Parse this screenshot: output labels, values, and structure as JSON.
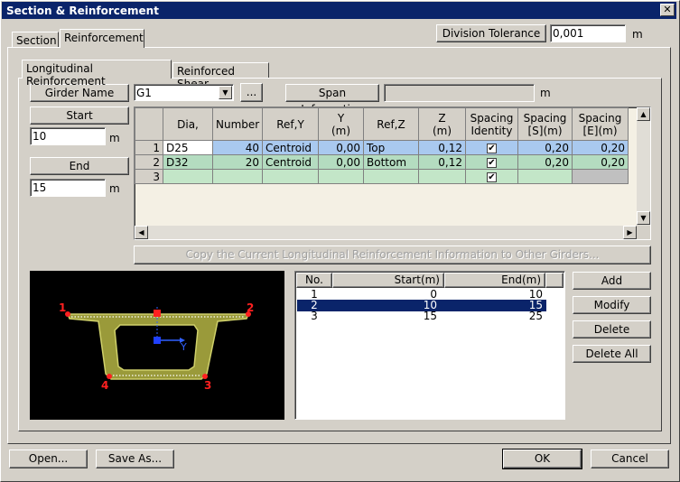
{
  "window": {
    "title": "Section & Reinforcement",
    "close_glyph": "✕"
  },
  "tabs": {
    "section": "Section",
    "reinforcement": "Reinforcement"
  },
  "division_tolerance": {
    "label": "Division Tolerance",
    "value": "0,001",
    "unit": "m"
  },
  "subtabs": {
    "longitudinal": "Longitudinal Reinforcement",
    "shear": "Reinforced Shear"
  },
  "girder": {
    "label": "Girder Name",
    "value": "G1",
    "browse_label": "...",
    "span_label": "Span Information",
    "span_value": "",
    "span_unit": "m"
  },
  "start": {
    "label": "Start",
    "value": "10",
    "unit": "m"
  },
  "end": {
    "label": "End",
    "value": "15",
    "unit": "m"
  },
  "grid": {
    "headers": [
      "",
      "Dia,",
      "Number",
      "Ref,Y",
      "Y\n(m)",
      "Ref,Z",
      "Z\n(m)",
      "Spacing\nIdentity",
      "Spacing\n[S](m)",
      "Spacing\n[E](m)"
    ],
    "rows": [
      {
        "no": "1",
        "dia": "D25",
        "number": "40",
        "refy": "Centroid",
        "y": "0,00",
        "refz": "Top",
        "z": "0,12",
        "identity": true,
        "ss": "0,20",
        "se": "0,20"
      },
      {
        "no": "2",
        "dia": "D32",
        "number": "20",
        "refy": "Centroid",
        "y": "0,00",
        "refz": "Bottom",
        "z": "0,12",
        "identity": true,
        "ss": "0,20",
        "se": "0,20"
      },
      {
        "no": "3",
        "dia": "",
        "number": "",
        "refy": "",
        "y": "",
        "refz": "",
        "z": "",
        "identity": true,
        "ss": "",
        "se": ""
      }
    ]
  },
  "copy_button": "Copy the Current Longitudinal Reinforcement Information to Other Girders...",
  "section_view": {
    "points": [
      "1",
      "2",
      "3",
      "4"
    ],
    "axis_label": "Y"
  },
  "ranges": {
    "headers": [
      "No.",
      "Start(m)",
      "End(m)"
    ],
    "rows": [
      {
        "no": "1",
        "start": "0",
        "end": "10",
        "selected": false
      },
      {
        "no": "2",
        "start": "10",
        "end": "15",
        "selected": true
      },
      {
        "no": "3",
        "start": "15",
        "end": "25",
        "selected": false
      }
    ]
  },
  "actions": {
    "add": "Add",
    "modify": "Modify",
    "delete": "Delete",
    "delete_all": "Delete All"
  },
  "footer": {
    "open": "Open...",
    "save_as": "Save As...",
    "ok": "OK",
    "cancel": "Cancel"
  },
  "colors": {
    "title_bar": "#0a246a",
    "dialog_bg": "#d4d0c8",
    "row_blue": "#a9c9ef",
    "row_green": "#b4dcc0",
    "section_fill": "#9a9a3a",
    "selection": "#0a246a"
  }
}
